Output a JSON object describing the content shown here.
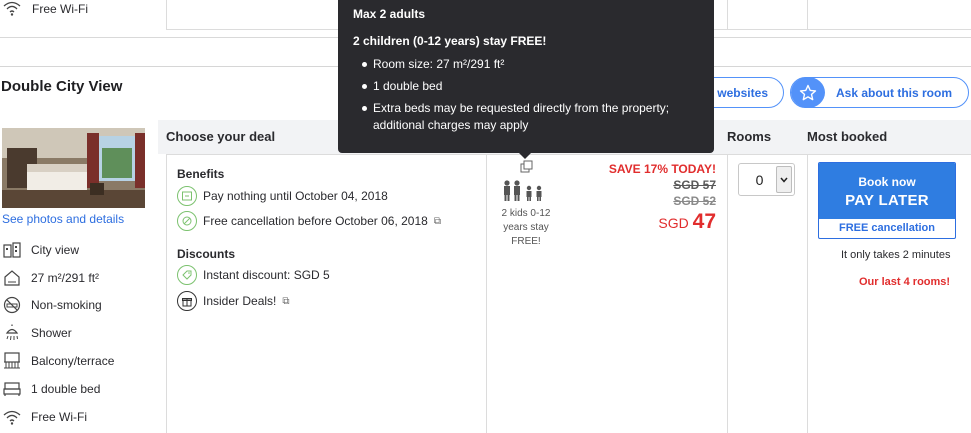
{
  "previous_room": {
    "wifi_label": "Free Wi-Fi"
  },
  "room": {
    "title": "Double City View",
    "photos_link": "See photos and details",
    "features": [
      {
        "icon": "city-view-icon",
        "label": "City view"
      },
      {
        "icon": "room-size-icon",
        "label": "27 m²/291 ft²"
      },
      {
        "icon": "non-smoking-icon",
        "label": "Non-smoking"
      },
      {
        "icon": "shower-icon",
        "label": "Shower"
      },
      {
        "icon": "balcony-icon",
        "label": "Balcony/terrace"
      },
      {
        "icon": "bed-icon",
        "label": "1 double bed"
      },
      {
        "icon": "wifi-icon",
        "label": "Free Wi-Fi"
      }
    ]
  },
  "actions": {
    "websites_label": "websites",
    "ask_label": "Ask about this room"
  },
  "columns": {
    "deal": "Choose your deal",
    "rooms": "Rooms",
    "most_booked": "Most booked"
  },
  "deal": {
    "benefits_title": "Benefits",
    "pay_nothing": "Pay nothing until October 04, 2018",
    "free_cancellation": "Free cancellation before October 06, 2018",
    "discounts_title": "Discounts",
    "instant_discount": "Instant discount: SGD 5",
    "insider_deals": "Insider Deals!"
  },
  "occupancy": {
    "kids_text_line1": "2 kids 0-12",
    "kids_text_line2": "years stay",
    "kids_text_line3": "FREE!"
  },
  "price": {
    "save_text": "SAVE 17% TODAY!",
    "original_1": "SGD 57",
    "original_2": "SGD 52",
    "currency": "SGD",
    "final": "47"
  },
  "rooms_select": {
    "value": "0"
  },
  "booking": {
    "line1": "Book now",
    "line2": "PAY LATER",
    "free_cancellation": "FREE cancellation",
    "takes_time": "It only takes 2 minutes",
    "last_rooms": "Our last 4 rooms!"
  },
  "tooltip": {
    "max_adults": "Max 2 adults",
    "children": "2 children (0-12 years) stay FREE!",
    "bullets": [
      "Room size: 27 m²/291 ft²",
      "1 double bed",
      "Extra beds may be requested directly from the property; additional charges may apply"
    ]
  },
  "colors": {
    "accent_blue": "#2f7de1",
    "price_red": "#e12d2d",
    "tooltip_bg": "#2a2a2e"
  }
}
